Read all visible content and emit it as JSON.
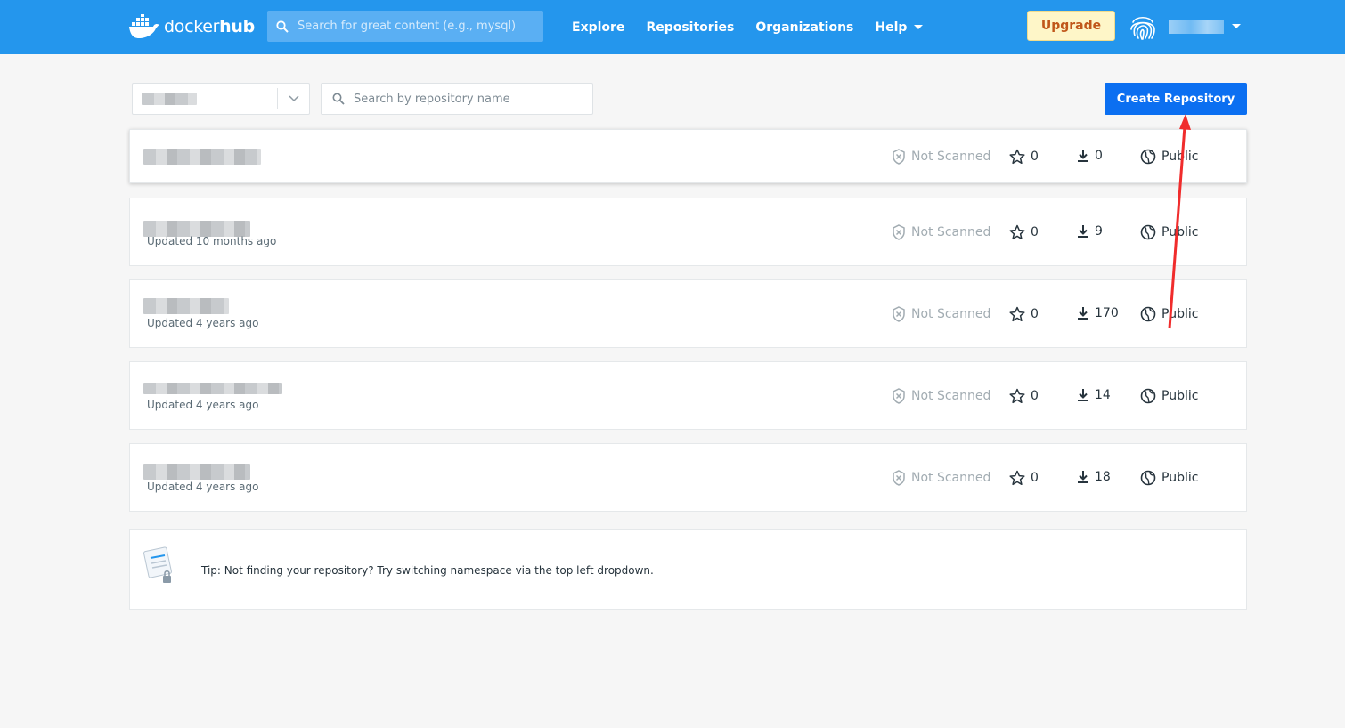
{
  "brand": {
    "logo_prefix": "docker",
    "logo_suffix": "hub",
    "color": "#2496ed"
  },
  "header": {
    "search_placeholder": "Search for great content (e.g., mysql)",
    "nav": [
      {
        "label": "Explore"
      },
      {
        "label": "Repositories"
      },
      {
        "label": "Organizations"
      },
      {
        "label": "Help"
      }
    ],
    "upgrade_label": "Upgrade",
    "user_avatar_icon": "fingerprint-icon"
  },
  "filters": {
    "repo_search_placeholder": "Search by repository name",
    "create_label": "Create Repository"
  },
  "repositories": [
    {
      "updated": "",
      "scan": "Not Scanned",
      "stars": "0",
      "pulls": "0",
      "visibility": "Public"
    },
    {
      "updated": "Updated 10 months ago",
      "scan": "Not Scanned",
      "stars": "0",
      "pulls": "9",
      "visibility": "Public"
    },
    {
      "updated": "Updated 4 years ago",
      "scan": "Not Scanned",
      "stars": "0",
      "pulls": "170",
      "visibility": "Public"
    },
    {
      "updated": "Updated 4 years ago",
      "scan": "Not Scanned",
      "stars": "0",
      "pulls": "14",
      "visibility": "Public"
    },
    {
      "updated": "Updated 4 years ago",
      "scan": "Not Scanned",
      "stars": "0",
      "pulls": "18",
      "visibility": "Public"
    }
  ],
  "tip": {
    "text": "Tip: Not finding your repository? Try switching namespace via the top left dropdown."
  },
  "colors": {
    "primary_button": "#0b6ff1",
    "upgrade_bg": "#fef6c8",
    "upgrade_text": "#c0571a",
    "annotation_arrow": "#f02c2c"
  }
}
